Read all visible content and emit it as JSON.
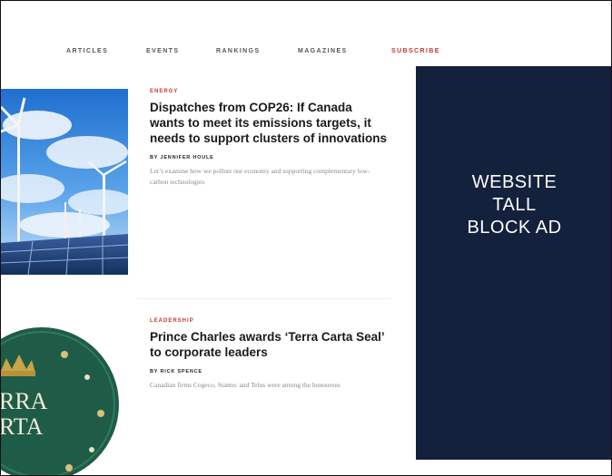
{
  "nav": {
    "items": [
      "ARTICLES",
      "EVENTS",
      "RANKINGS",
      "MAGAZINES"
    ],
    "subscribe": "SUBSCRIBE",
    "subscribe_color": "#c8372d"
  },
  "articles": [
    {
      "category": "ENERGY",
      "headline": "Dispatches from COP26: If Canada wants to meet its emissions targets, it needs to support clusters of innovations",
      "byline": "BY JENNIFER HOULE",
      "dek": "Let’s examine how we pollute our economy and supporting complementary low-carbon technologies",
      "thumbnail": "wind-turbines-solar-panels-photo"
    },
    {
      "category": "LEADERSHIP",
      "headline": "Prince Charles awards ‘Terra Carta Seal’ to corporate leaders",
      "byline": "BY RICK SPENCE",
      "dek": "Canadian firms Cogeco, Stantec and Telus were among the honourees",
      "thumbnail": "terra-carta-seal",
      "seal_text": [
        "RRA",
        "RTA"
      ]
    }
  ],
  "ad": {
    "label": "WEBSITE\nTALL\nBLOCK AD",
    "background": "#13213d"
  }
}
